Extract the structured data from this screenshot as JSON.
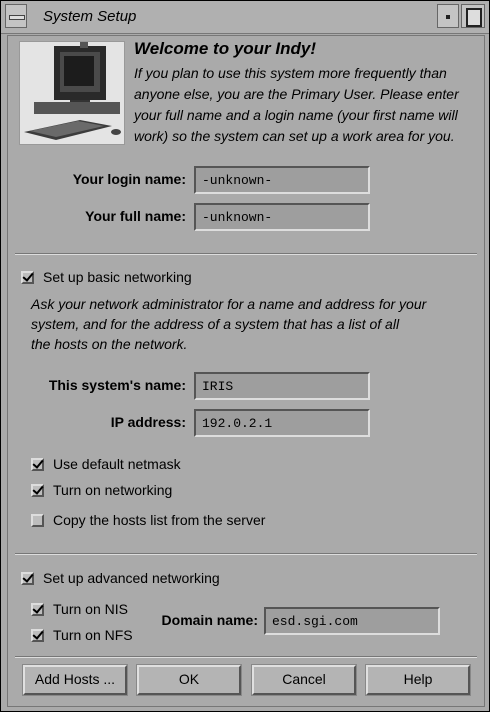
{
  "window": {
    "title": "System Setup"
  },
  "welcome": {
    "title": "Welcome to your Indy!",
    "lines": [
      "If you plan to use this system more frequently than",
      "anyone else,  you are the Primary User.  Please enter",
      "your full name and a login name (your first name will",
      "work) so the system can set up a work area for you."
    ]
  },
  "user": {
    "login_label": "Your login name:",
    "login_value": "-unknown-",
    "fullname_label": "Your full name:",
    "fullname_value": "-unknown-"
  },
  "basic_net": {
    "toggle_label": "Set up basic networking",
    "checked": true,
    "lines": [
      "Ask your network administrator for a name and address for your",
      "system, and for the address of a system that has a list of all",
      "the hosts on the network."
    ],
    "name_label": "This system's name:",
    "name_value": "IRIS",
    "ip_label": "IP address:",
    "ip_value": "192.0.2.1",
    "netmask_label": "Use default netmask",
    "netmask_checked": true,
    "networking_label": "Turn on networking",
    "networking_checked": true,
    "hosts_label": "Copy the hosts list from the server",
    "hosts_checked": false
  },
  "advanced_net": {
    "toggle_label": "Set up advanced networking",
    "checked": true,
    "nis_label": "Turn on NIS",
    "nis_checked": true,
    "nfs_label": "Turn on NFS",
    "nfs_checked": true,
    "domain_label": "Domain name:",
    "domain_value": "esd.sgi.com"
  },
  "buttons": {
    "add_hosts": "Add Hosts ...",
    "ok": "OK",
    "cancel": "Cancel",
    "help": "Help"
  }
}
